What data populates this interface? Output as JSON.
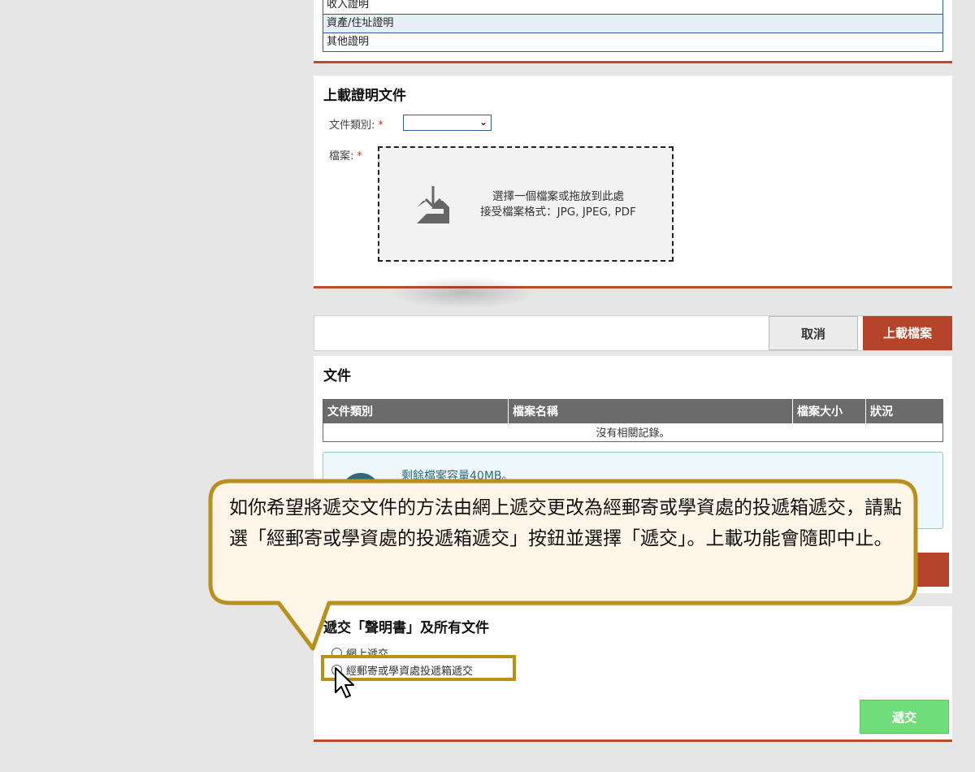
{
  "proof_list": {
    "items": [
      "收入證明",
      "資產/住址證明",
      "其他證明"
    ]
  },
  "upload": {
    "title": "上載證明文件",
    "doc_type_label": "文件類別:",
    "file_label": "檔案:",
    "required_mark": "*",
    "dropzone_line1": "選擇一個檔案或拖放到此處",
    "dropzone_line2": "接受檔案格式：JPG, JPEG, PDF",
    "icon": "download-tray-icon"
  },
  "actions": {
    "cancel_label": "取消",
    "upload_label": "上載檔案"
  },
  "documents": {
    "title": "文件",
    "columns": [
      "文件類別",
      "檔案名稱",
      "檔案大小",
      "狀況"
    ],
    "empty_text": "沒有相關記錄。",
    "quota_text": "剩餘檔案容量40MB。"
  },
  "submission": {
    "title": "遞交「聲明書」及所有文件",
    "option_online": "網上遞交",
    "option_post": "經郵寄或學資處投遞箱遞交",
    "submit_label": "遞交"
  },
  "callout": {
    "text": "如你希望將遞交文件的方法由網上遞交更改為經郵寄或學資處的投遞箱遞交，請點選「經郵寄或學資處的投遞箱遞交」按鈕並選擇「遞交」。上載功能會隨即中止。"
  },
  "colors": {
    "accent_border": "#b5502b",
    "upload_button": "#b5442a",
    "submit_button": "#6fdd7a",
    "callout_border": "#b8901a",
    "callout_fill": "#fdf5e8"
  }
}
